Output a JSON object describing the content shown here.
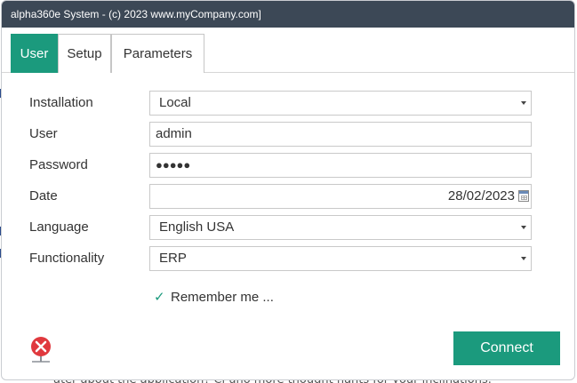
{
  "window": {
    "title": "alpha360e System - (c) 2023 www.myCompany.com]"
  },
  "tabs": [
    {
      "label": "User",
      "active": true
    },
    {
      "label": "Setup",
      "active": false
    },
    {
      "label": "Parameters",
      "active": false
    }
  ],
  "form": {
    "installation": {
      "label": "Installation",
      "value": "Local"
    },
    "user": {
      "label": "User",
      "value": "admin"
    },
    "password": {
      "label": "Password",
      "value": "●●●●●"
    },
    "date": {
      "label": "Date",
      "value": "28/02/2023"
    },
    "language": {
      "label": "Language",
      "value": "English USA"
    },
    "functionality": {
      "label": "Functionality",
      "value": "ERP"
    }
  },
  "remember": {
    "label": "Remember me ...",
    "checked": true,
    "check_glyph": "✓"
  },
  "connect_label": "Connect",
  "background_text": "ater about the application? Ci uno more thought hants for your inclinations.",
  "colors": {
    "accent": "#1b9a7d",
    "titlebar": "#3c4856",
    "exit_icon": "#e0393e"
  },
  "icons": {
    "exit": "exit-icon",
    "calendar": "calendar-icon",
    "dropdown": "chevron-down-icon",
    "check": "check-icon"
  }
}
